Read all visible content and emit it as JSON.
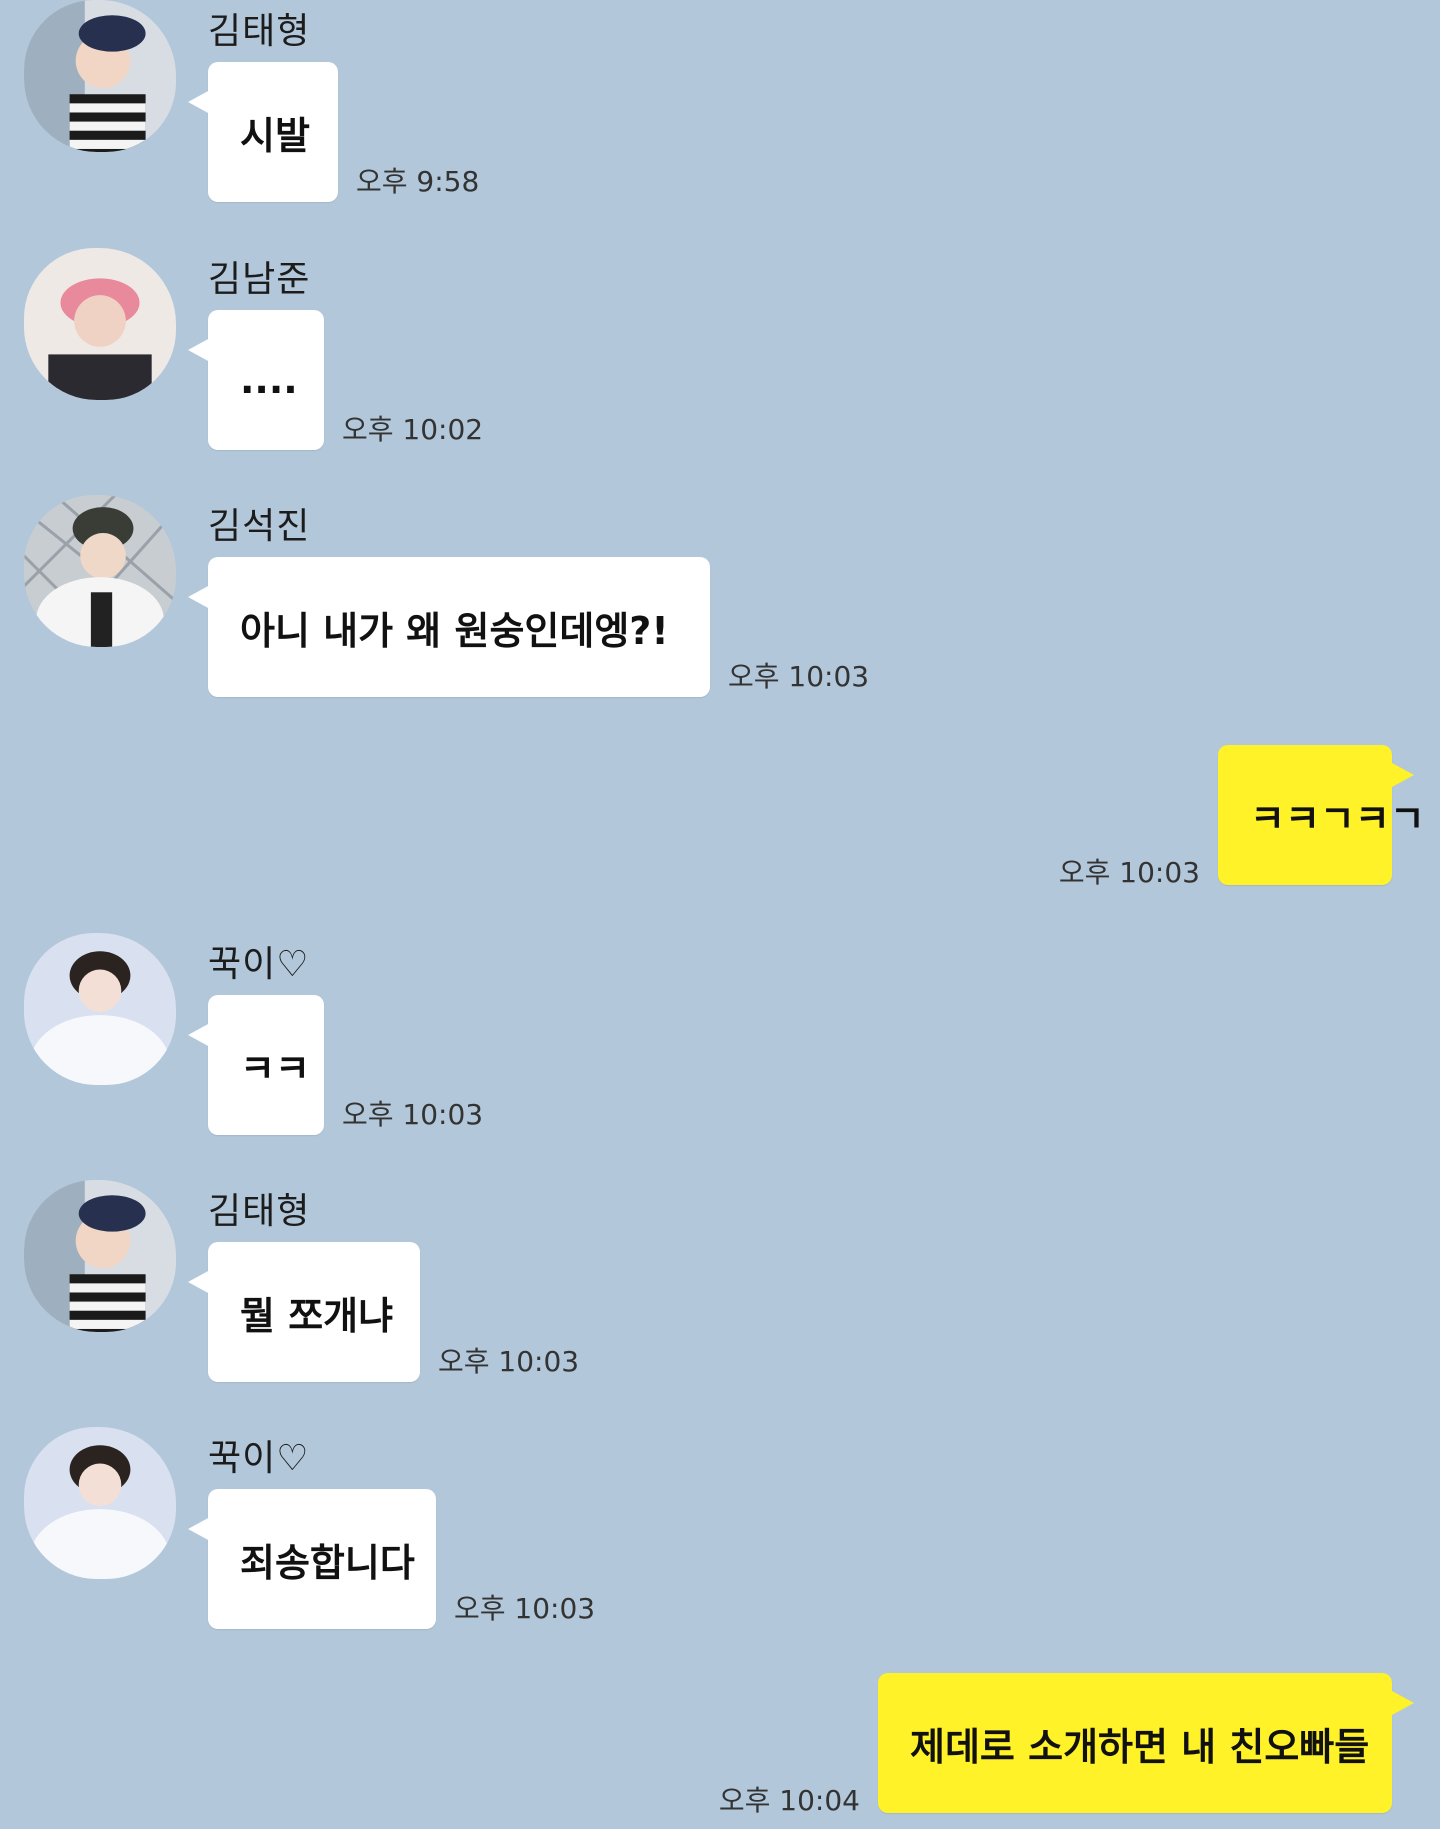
{
  "messages": [
    {
      "type": "in",
      "sender": "김태형",
      "text": "시발",
      "time": "오후 9:58",
      "avatar": "avatar-taehyung"
    },
    {
      "type": "in",
      "sender": "김남준",
      "text": "....",
      "time": "오후 10:02",
      "avatar": "avatar-namjoon"
    },
    {
      "type": "in",
      "sender": "김석진",
      "text": "아니 내가 왜 원숭인데엥?!",
      "time": "오후 10:03",
      "avatar": "avatar-seokjin"
    },
    {
      "type": "out",
      "text": "ㅋㅋㄱㅋㄱ",
      "time": "오후 10:03"
    },
    {
      "type": "in",
      "sender": "꾹이♡",
      "text": "ㅋㅋ",
      "time": "오후 10:03",
      "avatar": "avatar-jungkook"
    },
    {
      "type": "in",
      "sender": "김태형",
      "text": "뭘 쪼개냐",
      "time": "오후 10:03",
      "avatar": "avatar-taehyung"
    },
    {
      "type": "in",
      "sender": "꾹이♡",
      "text": "죄송합니다",
      "time": "오후 10:03",
      "avatar": "avatar-jungkook"
    },
    {
      "type": "out",
      "text": "제데로 소개하면 내 친오빠들",
      "time": "오후 10:04"
    }
  ],
  "colors": {
    "background": "#b2c7da",
    "incoming_bubble": "#ffffff",
    "outgoing_bubble": "#fff228"
  }
}
